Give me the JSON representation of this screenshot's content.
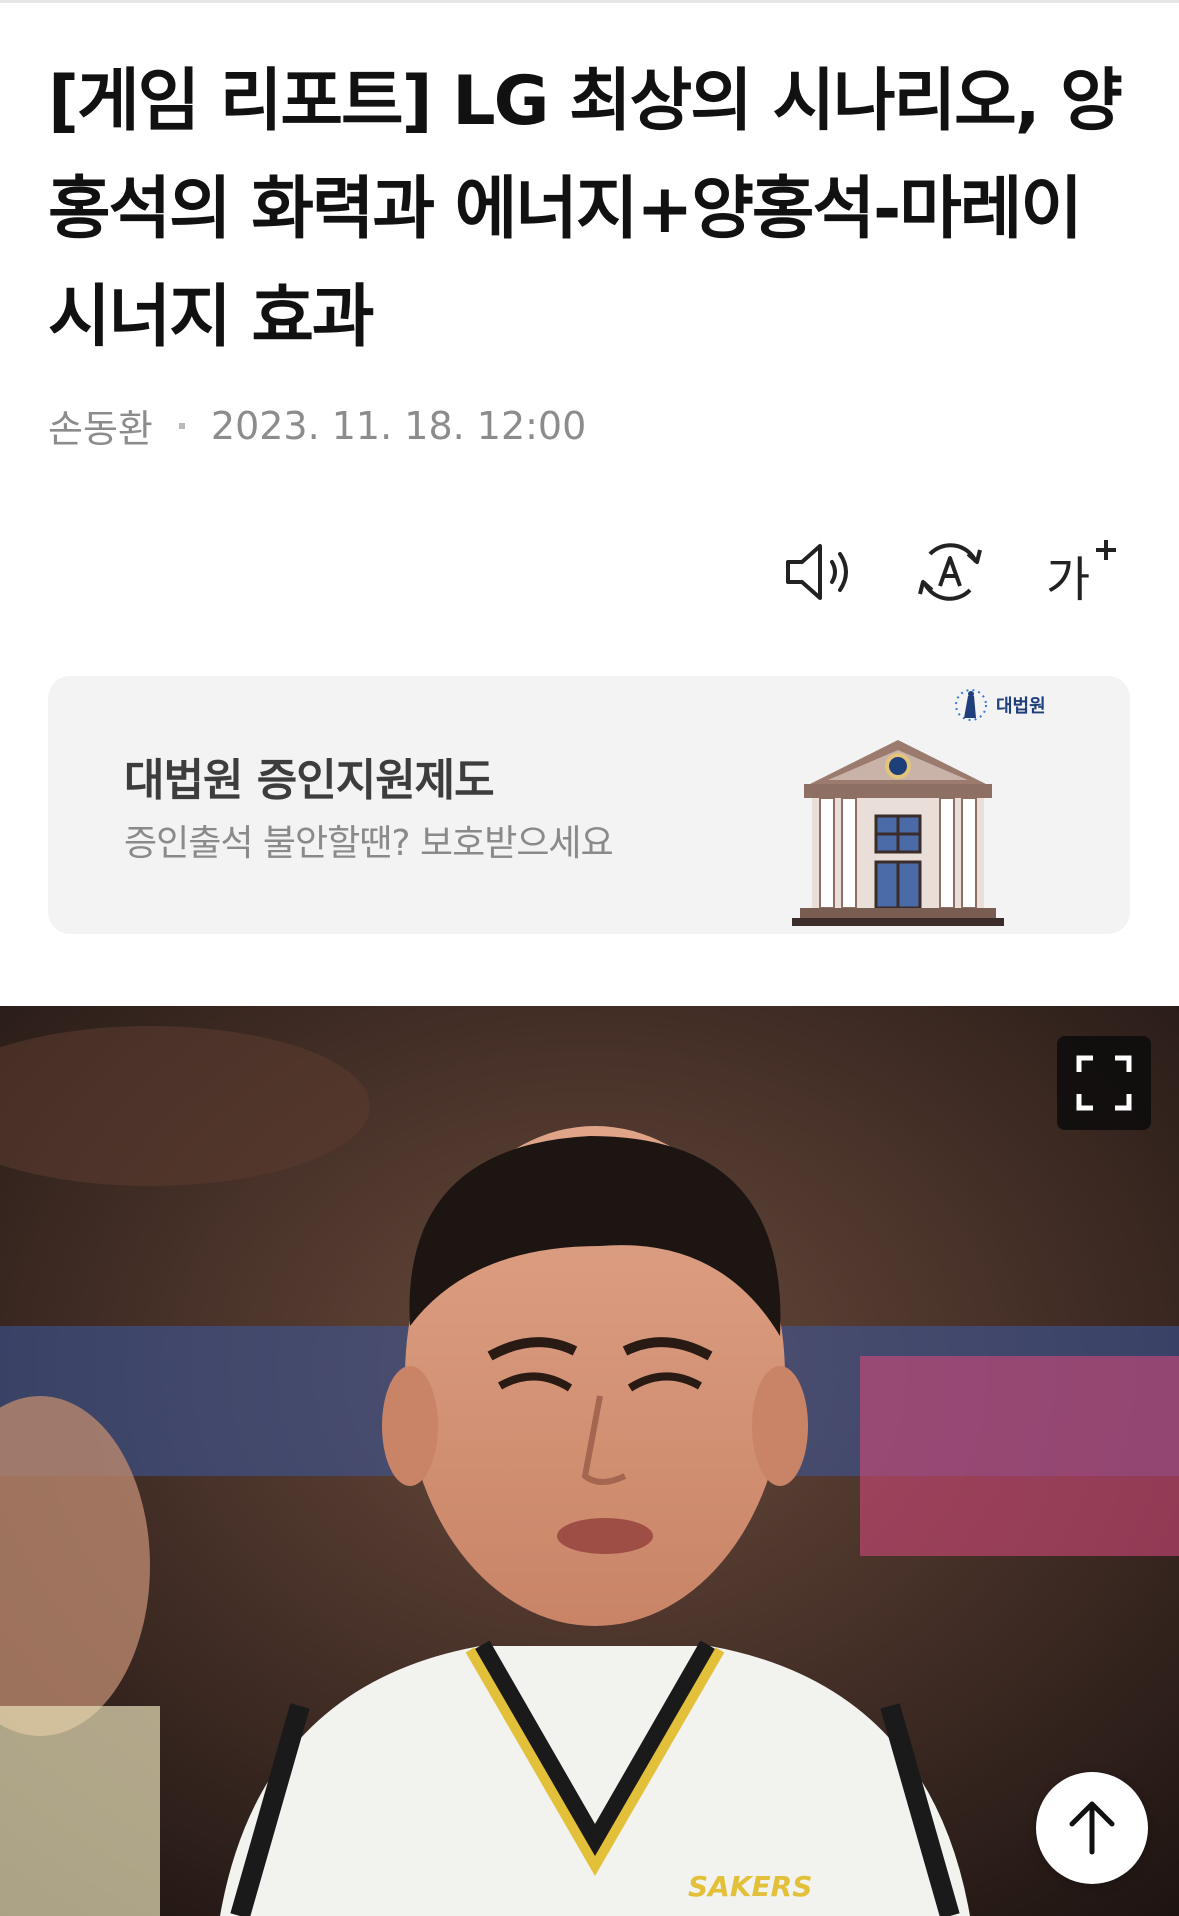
{
  "article": {
    "title": "[게임 리포트] LG 최상의 시나리오, 양홍석의 화력과 에너지+양홍석-마레이 시너지 효과",
    "author": "손동환",
    "date": "2023. 11. 18. 12:00"
  },
  "tools": {
    "speaker_icon": "speaker-icon",
    "translate_icon": "translate-icon",
    "font_icon": "font-size-icon",
    "font_label": "가"
  },
  "ad": {
    "title": "대법원 증인지원제도",
    "subtitle": "증인출석 불안할땐? 보호받으세요",
    "logo_text": "대법원",
    "image_icon": "courthouse-icon",
    "colors": {
      "background": "#f3f3f3",
      "building": "#8e6f63"
    }
  },
  "photo": {
    "jersey_text": "SAKERS",
    "expand_icon": "fullscreen-icon"
  },
  "scroll_top_icon": "arrow-up-icon"
}
